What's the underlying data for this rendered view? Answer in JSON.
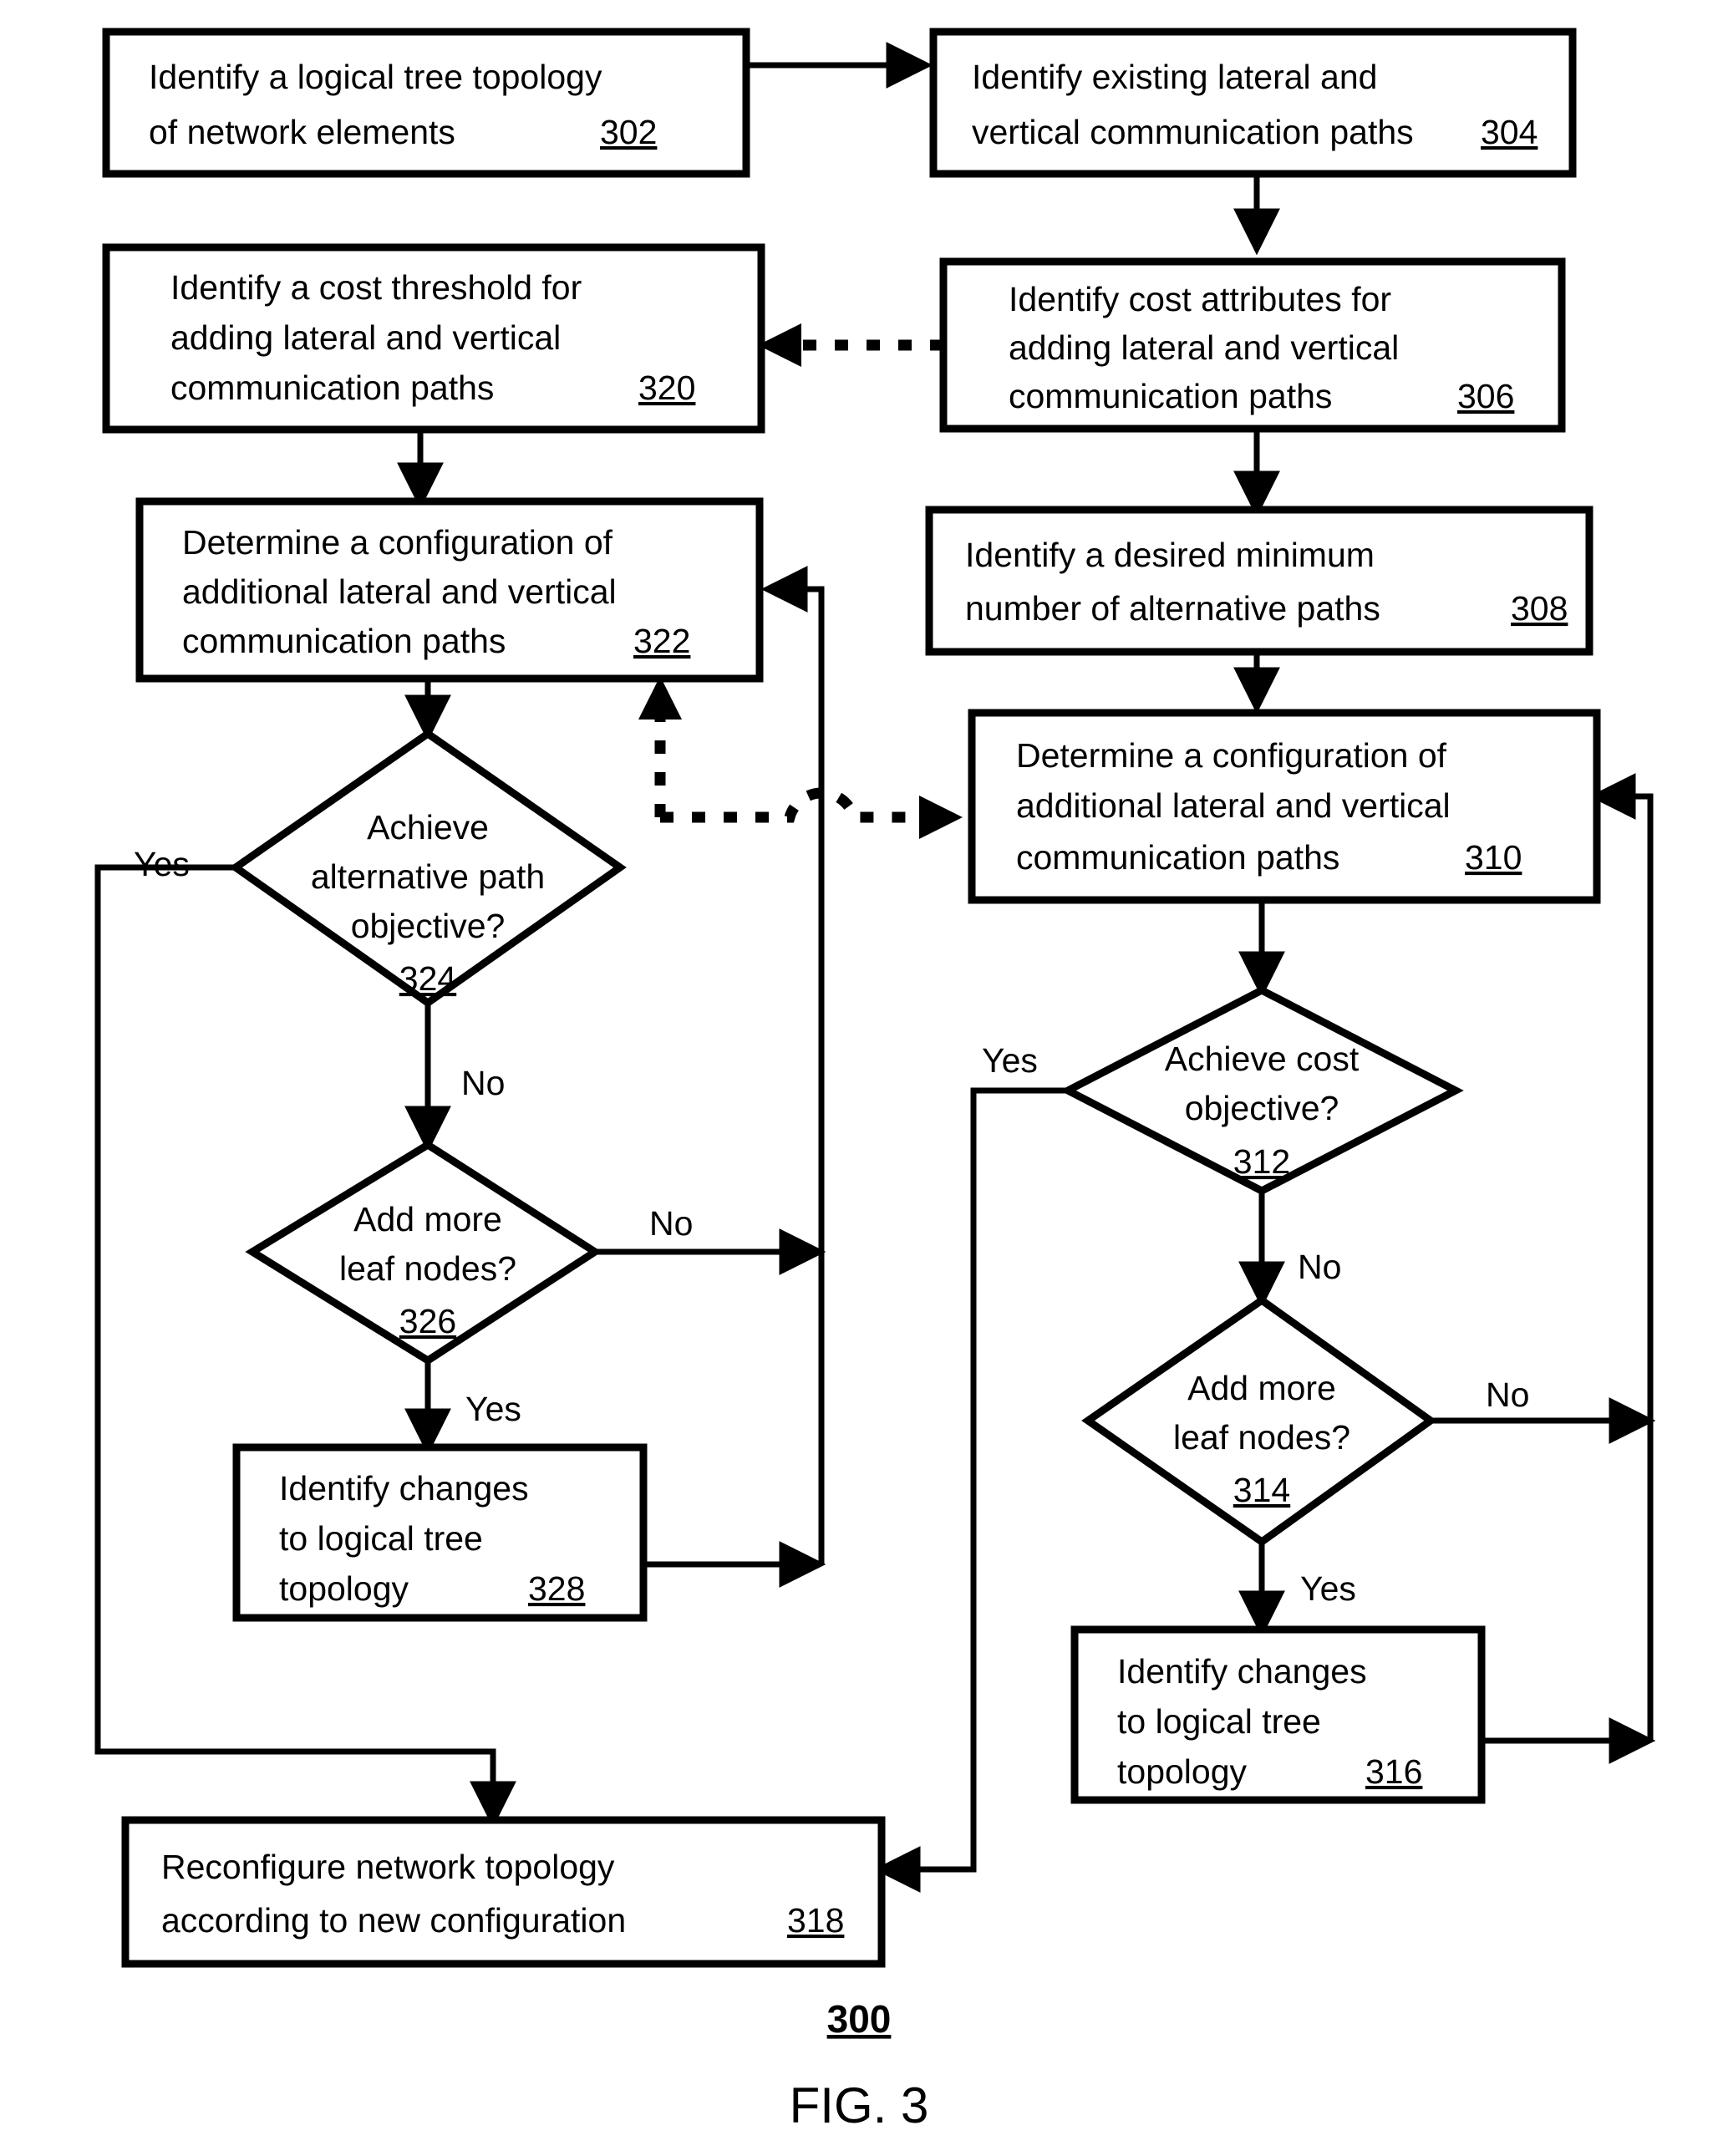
{
  "figure": {
    "number_label": "300",
    "caption": "FIG. 3"
  },
  "nodes": {
    "n302": {
      "ref": "302",
      "lines": [
        "Identify a logical tree topology",
        "of network elements"
      ],
      "shape": "process"
    },
    "n304": {
      "ref": "304",
      "lines": [
        "Identify existing lateral and",
        "vertical communication paths"
      ],
      "shape": "process"
    },
    "n320": {
      "ref": "320",
      "lines": [
        "Identify a cost threshold for",
        "adding lateral and vertical",
        "communication paths"
      ],
      "shape": "process"
    },
    "n306": {
      "ref": "306",
      "lines": [
        "Identify cost attributes for",
        "adding lateral and vertical",
        "communication paths"
      ],
      "shape": "process"
    },
    "n322": {
      "ref": "322",
      "lines": [
        "Determine a configuration of",
        "additional lateral and vertical",
        "communication paths"
      ],
      "shape": "process"
    },
    "n308": {
      "ref": "308",
      "lines": [
        "Identify a desired minimum",
        "number of alternative paths"
      ],
      "shape": "process"
    },
    "n310": {
      "ref": "310",
      "lines": [
        "Determine a configuration of",
        "additional lateral and vertical",
        "communication paths"
      ],
      "shape": "process"
    },
    "n324": {
      "ref": "324",
      "lines": [
        "Achieve",
        "alternative path",
        "objective?"
      ],
      "shape": "decision"
    },
    "n312": {
      "ref": "312",
      "lines": [
        "Achieve cost",
        "objective?"
      ],
      "shape": "decision"
    },
    "n326": {
      "ref": "326",
      "lines": [
        "Add more",
        "leaf nodes?"
      ],
      "shape": "decision"
    },
    "n314": {
      "ref": "314",
      "lines": [
        "Add more",
        "leaf nodes?"
      ],
      "shape": "decision"
    },
    "n328": {
      "ref": "328",
      "lines": [
        "Identify changes",
        "to logical tree",
        "topology"
      ],
      "shape": "process"
    },
    "n316": {
      "ref": "316",
      "lines": [
        "Identify changes",
        "to logical tree",
        "topology"
      ],
      "shape": "process"
    },
    "n318": {
      "ref": "318",
      "lines": [
        "Reconfigure network topology",
        "according to new configuration"
      ],
      "shape": "process"
    }
  },
  "edge_labels": {
    "yes_324": "Yes",
    "no_324": "No",
    "no_326": "No",
    "yes_326": "Yes",
    "yes_312": "Yes",
    "no_312": "No",
    "no_314": "No",
    "yes_314": "Yes"
  },
  "colors": {
    "stroke": "#000000",
    "fill": "#ffffff",
    "background": "#ffffff"
  }
}
